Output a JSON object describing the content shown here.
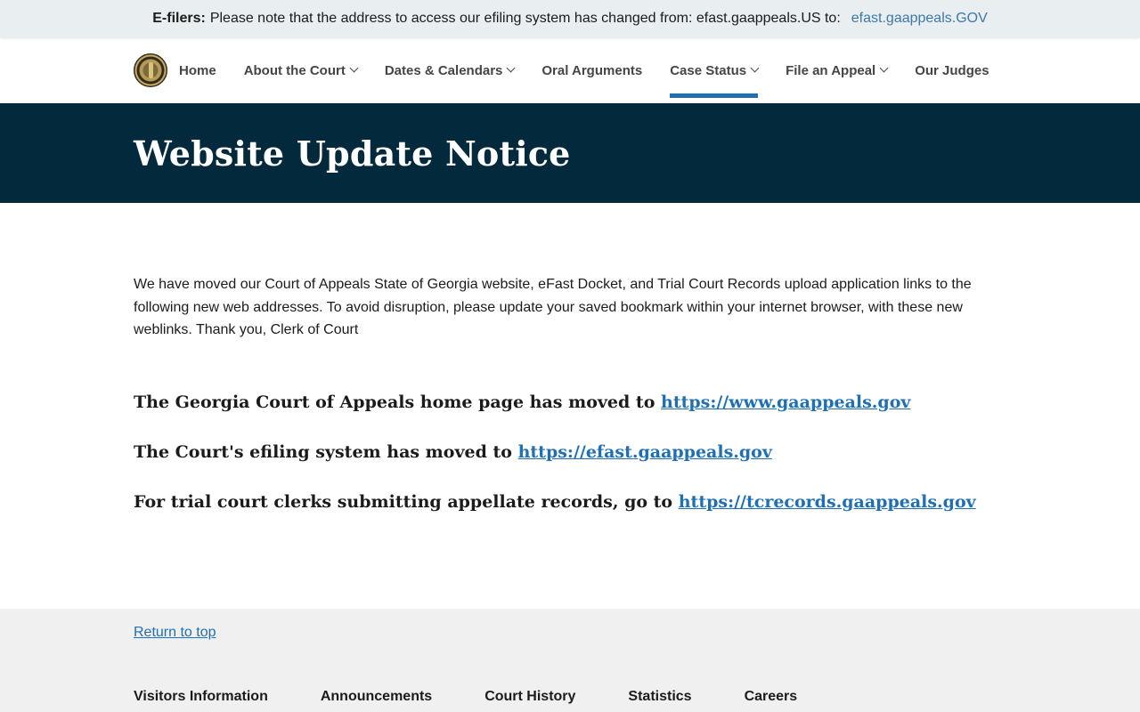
{
  "alert": {
    "label": "E-filers:",
    "message": "Please note that the address to access our efiling system has changed from: efast.gaappeals.US to:",
    "link_text": "efast.gaappeals.GOV"
  },
  "nav": {
    "items": [
      {
        "label": "Home",
        "dropdown": false
      },
      {
        "label": "About the Court",
        "dropdown": true
      },
      {
        "label": "Dates & Calendars",
        "dropdown": true
      },
      {
        "label": "Oral Arguments",
        "dropdown": false
      },
      {
        "label": "Case Status",
        "dropdown": true,
        "active": true
      },
      {
        "label": "File an Appeal",
        "dropdown": true
      },
      {
        "label": "Our Judges",
        "dropdown": false
      }
    ]
  },
  "hero": {
    "title": "Website Update Notice"
  },
  "main": {
    "intro": "We have moved our Court of Appeals State of Georgia website, eFast Docket, and Trial Court Records upload application links to the following new web addresses. To avoid disruption, please update your saved bookmark within your internet browser, with these new weblinks. Thank you, Clerk of Court",
    "lines": [
      {
        "text": "The Georgia Court of Appeals home page has moved to",
        "link": "https://www.gaappeals.gov"
      },
      {
        "text": "The Court's efiling system has moved to",
        "link": "https://efast.gaappeals.gov"
      },
      {
        "text": "For trial court clerks submitting appellate records, go to",
        "link": "https://tcrecords.gaappeals.gov"
      }
    ]
  },
  "footer": {
    "return_top": "Return to top",
    "links": [
      "Visitors Information",
      "Announcements",
      "Court History",
      "Statistics",
      "Careers"
    ]
  },
  "colors": {
    "hero_bg": "#022a3c",
    "link": "#1f6fb2",
    "alert_bg": "#e9eef1",
    "footer_bg": "#f0f0f0"
  }
}
